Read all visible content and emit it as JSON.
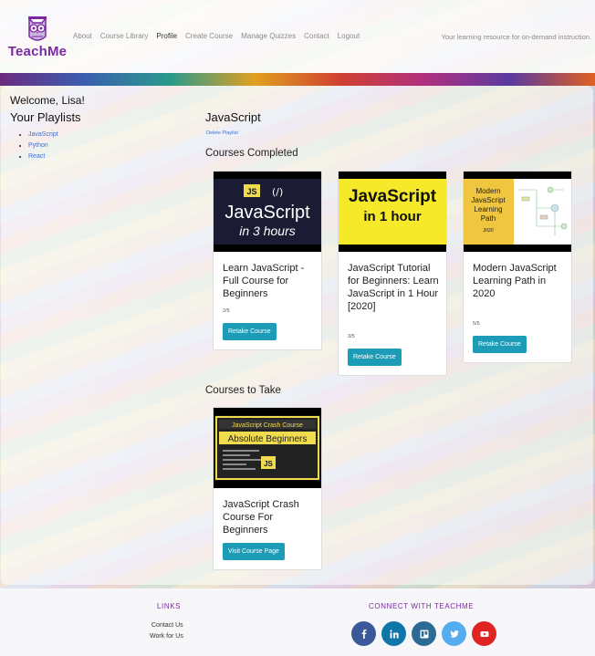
{
  "brand": {
    "name": "TeachMe",
    "tagline": "Your learning resource for on-demand instruction."
  },
  "nav": [
    {
      "label": "About"
    },
    {
      "label": "Course Library"
    },
    {
      "label": "Profile",
      "active": true
    },
    {
      "label": "Create Course"
    },
    {
      "label": "Manage Quizzes"
    },
    {
      "label": "Contact"
    },
    {
      "label": "Logout"
    }
  ],
  "welcome": "Welcome, Lisa!",
  "playlists": {
    "title": "Your Playlists",
    "items": [
      "JavaScript",
      "Python",
      "React"
    ]
  },
  "current_playlist": {
    "title": "JavaScript",
    "delete_label": "Delete Playlist"
  },
  "completed": {
    "title": "Courses Completed",
    "courses": [
      {
        "title": "Learn JavaScript - Full Course for Beginners",
        "progress": "2/5",
        "button": "Retake Course",
        "thumb": {
          "line1": "JavaScript",
          "line2": "in 3 hours",
          "tag": "JS"
        }
      },
      {
        "title": "JavaScript Tutorial for Beginners: Learn JavaScript in 1 Hour [2020]",
        "progress": "3/5",
        "button": "Retake Course",
        "thumb": {
          "line1": "JavaScript",
          "line2": "in 1 hour"
        }
      },
      {
        "title": "Modern JavaScript Learning Path in 2020",
        "progress": "5/5",
        "button": "Retake Course",
        "thumb": {
          "line1": "Modern",
          "line2": "JavaScript",
          "line3": "Learning",
          "line4": "Path",
          "line5": "2020"
        }
      }
    ]
  },
  "to_take": {
    "title": "Courses to Take",
    "courses": [
      {
        "title": "JavaScript Crash Course For Beginners",
        "button": "Visit Course Page",
        "thumb": {
          "line1": "JavaScript Crash Course",
          "line2": "Absolute Beginners",
          "tag": "JS"
        }
      }
    ]
  },
  "footer": {
    "links_title": "LINKS",
    "links": [
      "Contact Us",
      "Work for Us"
    ],
    "connect_title": "CONNECT WITH TEACHME",
    "social": [
      {
        "icon": "facebook-icon",
        "color": "#3b5998"
      },
      {
        "icon": "linkedin-icon",
        "color": "#0e76a8"
      },
      {
        "icon": "trello-icon",
        "color": "#2b6a94"
      },
      {
        "icon": "twitter-icon",
        "color": "#55acee"
      },
      {
        "icon": "youtube-icon",
        "color": "#e02424"
      }
    ]
  },
  "colors": {
    "brand": "#7a2aa0",
    "button": "#1c9cb6",
    "link": "#3b6fd8"
  }
}
